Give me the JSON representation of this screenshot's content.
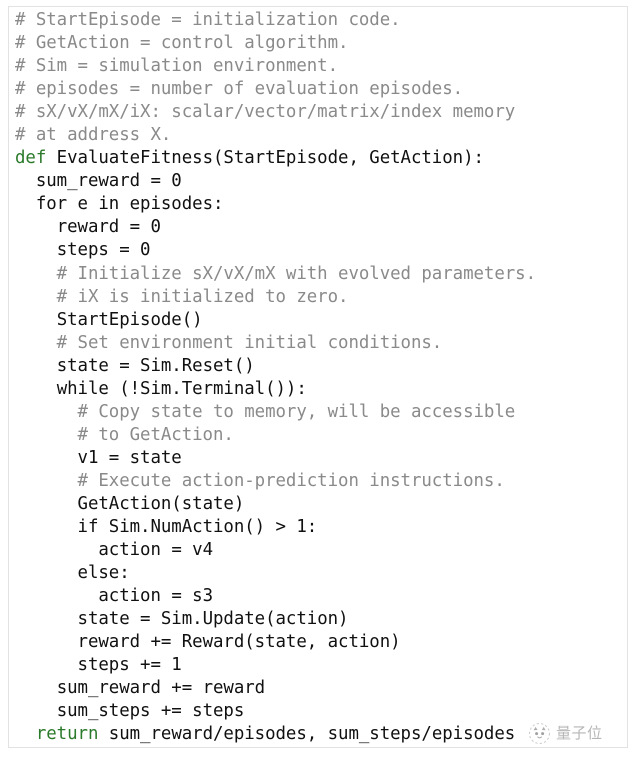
{
  "figure": {
    "kind": "code-listing",
    "language": "python-pseudocode",
    "colors": {
      "background": "#ffffff",
      "border": "#e2e2e2",
      "comment": "#8a8a8a",
      "keyword": "#2b7a2b",
      "code": "#101010",
      "watermark": "#9a9a9a"
    }
  },
  "code": {
    "lines": [
      {
        "indent": 0,
        "comment": "# StartEpisode = initialization code."
      },
      {
        "indent": 0,
        "comment": "# GetAction = control algorithm."
      },
      {
        "indent": 0,
        "comment": "# Sim = simulation environment."
      },
      {
        "indent": 0,
        "comment": "# episodes = number of evaluation episodes."
      },
      {
        "indent": 0,
        "comment": "# sX/vX/mX/iX: scalar/vector/matrix/index memory"
      },
      {
        "indent": 0,
        "comment": "# at address X."
      },
      {
        "indent": 0,
        "keyword": "def",
        "code": " EvaluateFitness(StartEpisode, GetAction):"
      },
      {
        "indent": 1,
        "code": "sum_reward = 0"
      },
      {
        "indent": 1,
        "code": "for e in episodes:"
      },
      {
        "indent": 2,
        "code": "reward = 0"
      },
      {
        "indent": 2,
        "code": "steps = 0"
      },
      {
        "indent": 2,
        "comment": "# Initialize sX/vX/mX with evolved parameters."
      },
      {
        "indent": 2,
        "comment": "# iX is initialized to zero."
      },
      {
        "indent": 2,
        "code": "StartEpisode()"
      },
      {
        "indent": 2,
        "comment": "# Set environment initial conditions."
      },
      {
        "indent": 2,
        "code": "state = Sim.Reset()"
      },
      {
        "indent": 2,
        "code": "while (!Sim.Terminal()):"
      },
      {
        "indent": 3,
        "comment": "# Copy state to memory, will be accessible"
      },
      {
        "indent": 3,
        "comment": "# to GetAction."
      },
      {
        "indent": 3,
        "code": "v1 = state"
      },
      {
        "indent": 3,
        "comment": "# Execute action-prediction instructions."
      },
      {
        "indent": 3,
        "code": "GetAction(state)"
      },
      {
        "indent": 3,
        "code": "if Sim.NumAction() > 1:"
      },
      {
        "indent": 4,
        "code": "action = v4"
      },
      {
        "indent": 3,
        "code": "else:"
      },
      {
        "indent": 4,
        "code": "action = s3"
      },
      {
        "indent": 3,
        "code": "state = Sim.Update(action)"
      },
      {
        "indent": 3,
        "code": "reward += Reward(state, action)"
      },
      {
        "indent": 3,
        "code": "steps += 1"
      },
      {
        "indent": 2,
        "code": "sum_reward += reward"
      },
      {
        "indent": 2,
        "code": "sum_steps += steps"
      },
      {
        "indent": 1,
        "keyword": "return",
        "code": " sum_reward/episodes, sum_steps/episodes"
      }
    ]
  },
  "watermark": {
    "text": "量子位",
    "logo_label": "qbitai-cat-logo"
  }
}
